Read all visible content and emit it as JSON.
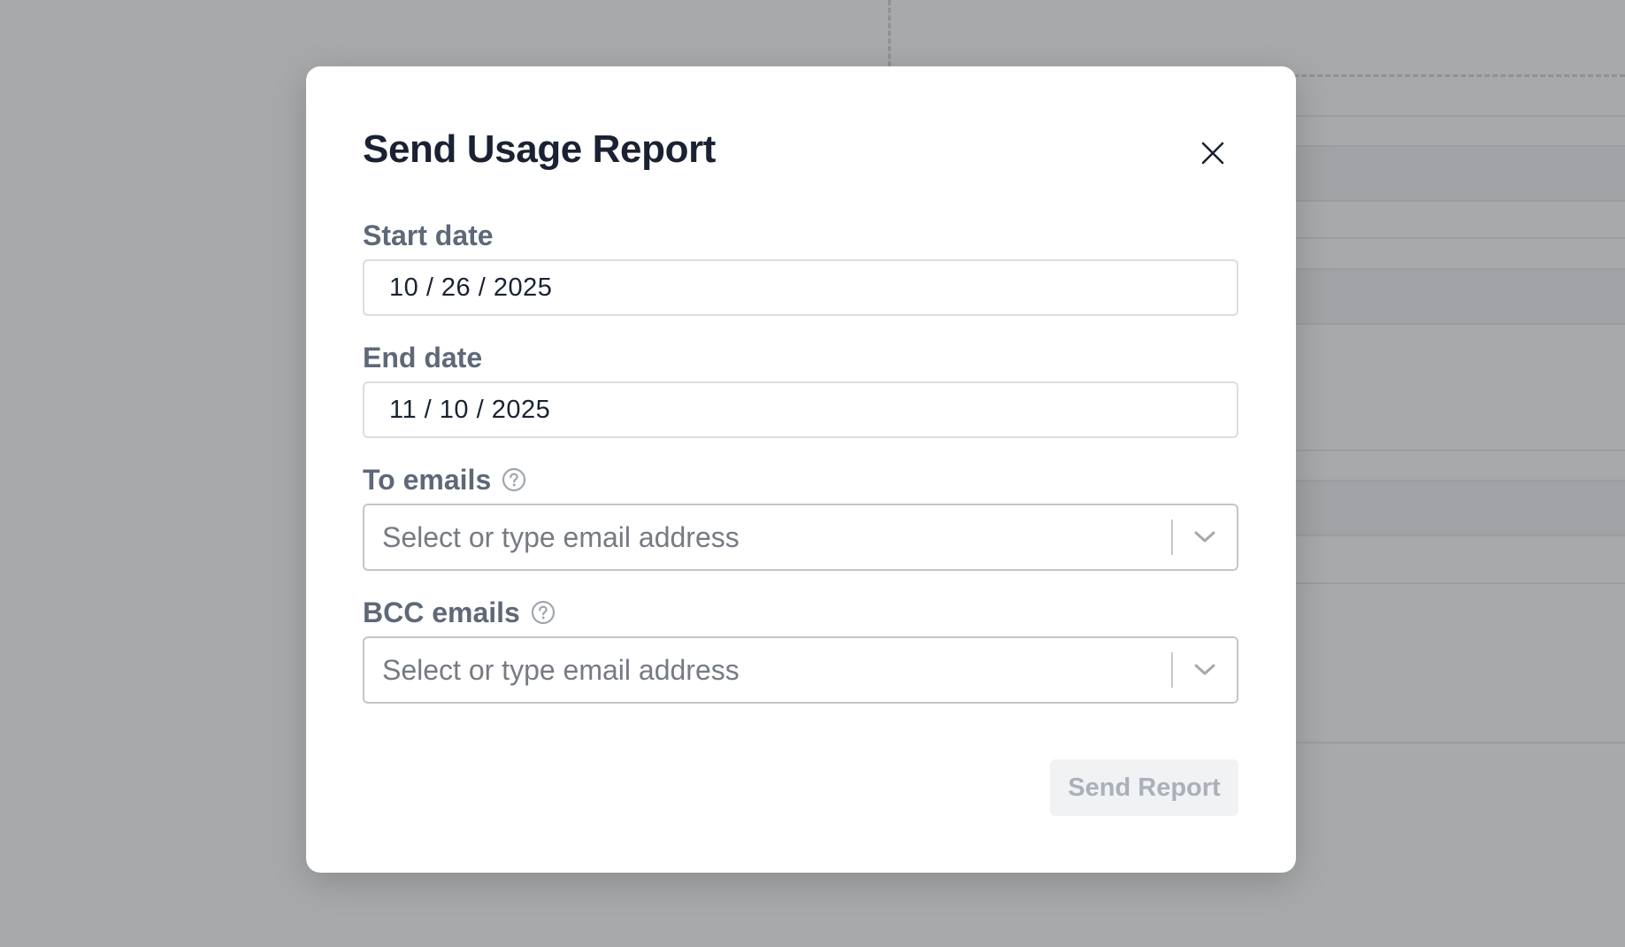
{
  "modal": {
    "title": "Send Usage Report",
    "start_date": {
      "label": "Start date",
      "value": "10 / 26 / 2025"
    },
    "end_date": {
      "label": "End date",
      "value": "11 / 10 / 2025"
    },
    "to_emails": {
      "label": "To emails",
      "placeholder": "Select or type email address"
    },
    "bcc_emails": {
      "label": "BCC emails",
      "placeholder": "Select or type email address"
    },
    "send_button_label": "Send Report"
  },
  "icons": {
    "close": "close-icon",
    "help": "help-circle-icon",
    "dropdown": "chevron-down-icon"
  },
  "colors": {
    "overlay": "#a8a9ab",
    "title": "#1a2232",
    "label": "#5e6878",
    "disabled_button_bg": "#f1f2f4",
    "disabled_button_text": "#aab0b9"
  }
}
